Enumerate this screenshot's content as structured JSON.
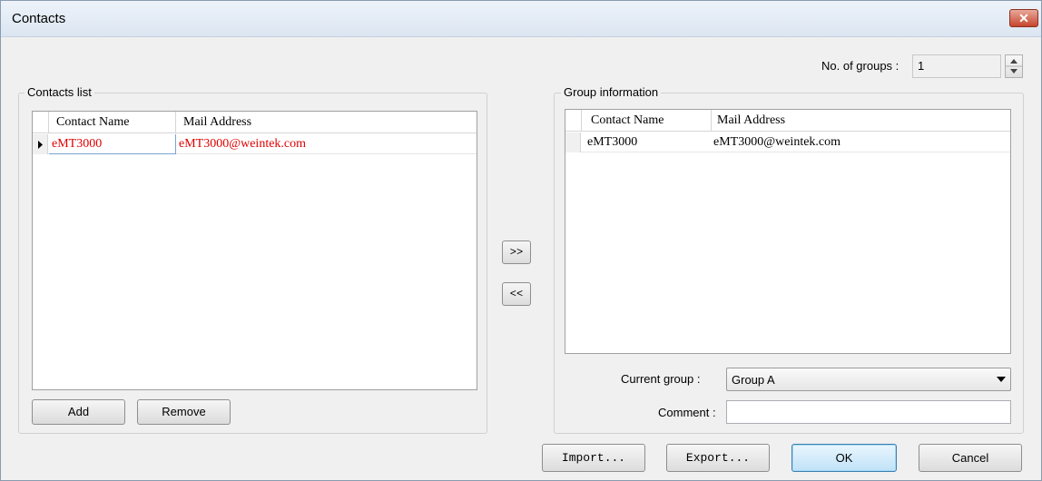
{
  "window": {
    "title": "Contacts",
    "close_label": "✕"
  },
  "groups_count": {
    "label": "No. of groups :",
    "value": "1"
  },
  "contacts_list": {
    "legend": "Contacts list",
    "columns": [
      "Contact Name",
      "Mail Address"
    ],
    "rows": [
      {
        "name": "eMT3000",
        "mail": "eMT3000@weintek.com"
      }
    ],
    "add_label": "Add",
    "remove_label": "Remove"
  },
  "transfer": {
    "add_label": ">>",
    "remove_label": "<<"
  },
  "group_information": {
    "legend": "Group information",
    "columns": [
      "Contact Name",
      "Mail Address"
    ],
    "rows": [
      {
        "name": "eMT3000",
        "mail": "eMT3000@weintek.com"
      }
    ],
    "current_group_label": "Current group :",
    "current_group_value": "Group A",
    "comment_label": "Comment :",
    "comment_value": ""
  },
  "footer": {
    "import_label": "Import...",
    "export_label": "Export...",
    "ok_label": "OK",
    "cancel_label": "Cancel"
  },
  "colors": {
    "highlight_text": "#e00000",
    "ok_border": "#3c7fb1"
  }
}
